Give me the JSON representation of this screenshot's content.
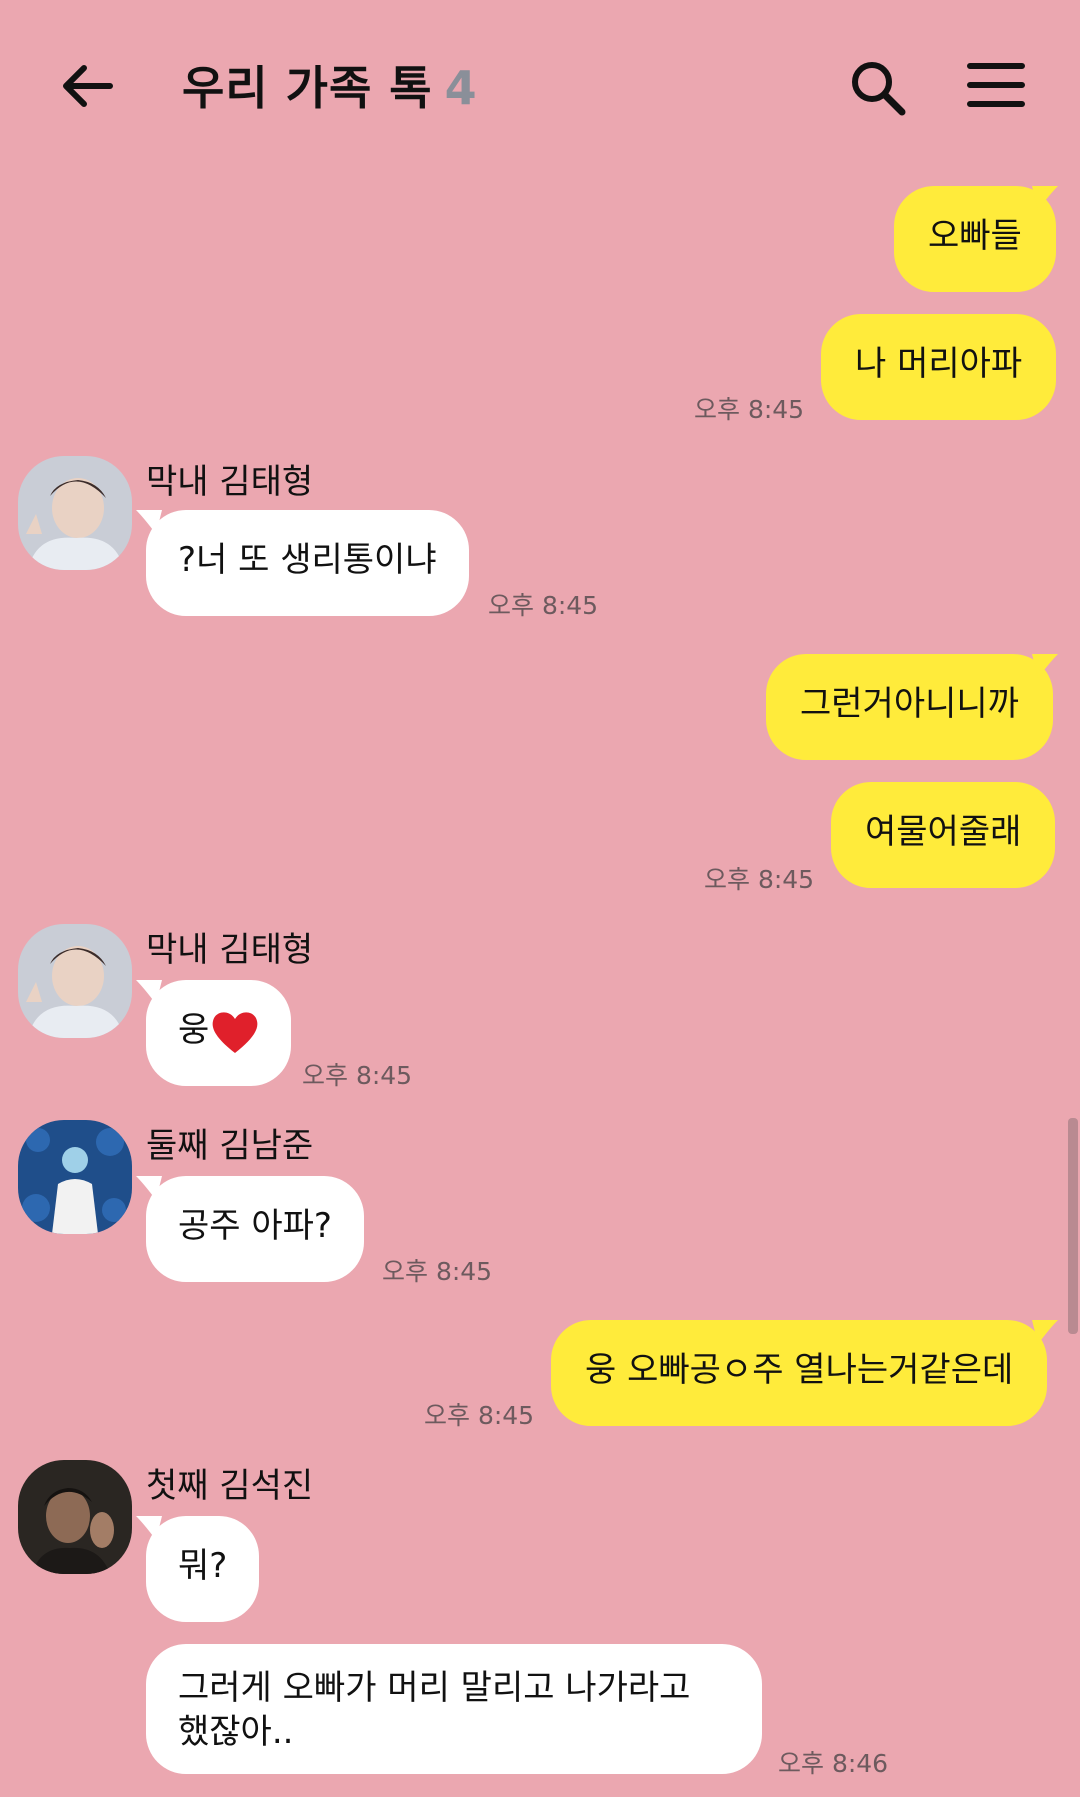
{
  "header": {
    "title": "우리 가족 톡",
    "member_count": "4",
    "back_icon": "arrow-left-icon",
    "search_icon": "search-icon",
    "menu_icon": "hamburger-menu-icon"
  },
  "colors": {
    "background": "#eba7b0",
    "my_bubble": "#ffeb3b",
    "other_bubble": "#ffffff"
  },
  "messages": [
    {
      "from": "me",
      "text": "오빠들"
    },
    {
      "from": "me",
      "text": "나 머리아파",
      "time": "오후 8:45"
    },
    {
      "from": "막내 김태형",
      "text": "?너 또 생리통이냐",
      "time": "오후 8:45"
    },
    {
      "from": "me",
      "text": "그런거아니니까"
    },
    {
      "from": "me",
      "text": "여물어줄래",
      "time": "오후 8:45"
    },
    {
      "from": "막내 김태형",
      "text": "웅",
      "emoji": "heart",
      "time": "오후 8:45"
    },
    {
      "from": "둘째 김남준",
      "text": "공주 아파?",
      "time": "오후 8:45"
    },
    {
      "from": "me",
      "text": "웅 오빠공ㅇ주 열나는거같은데",
      "time": "오후 8:45"
    },
    {
      "from": "첫째 김석진",
      "text": "뭐?"
    },
    {
      "from": "첫째 김석진",
      "text": "그러게 오빠가 머리 말리고 나가라고 했잖아..",
      "time": "오후 8:46"
    }
  ]
}
